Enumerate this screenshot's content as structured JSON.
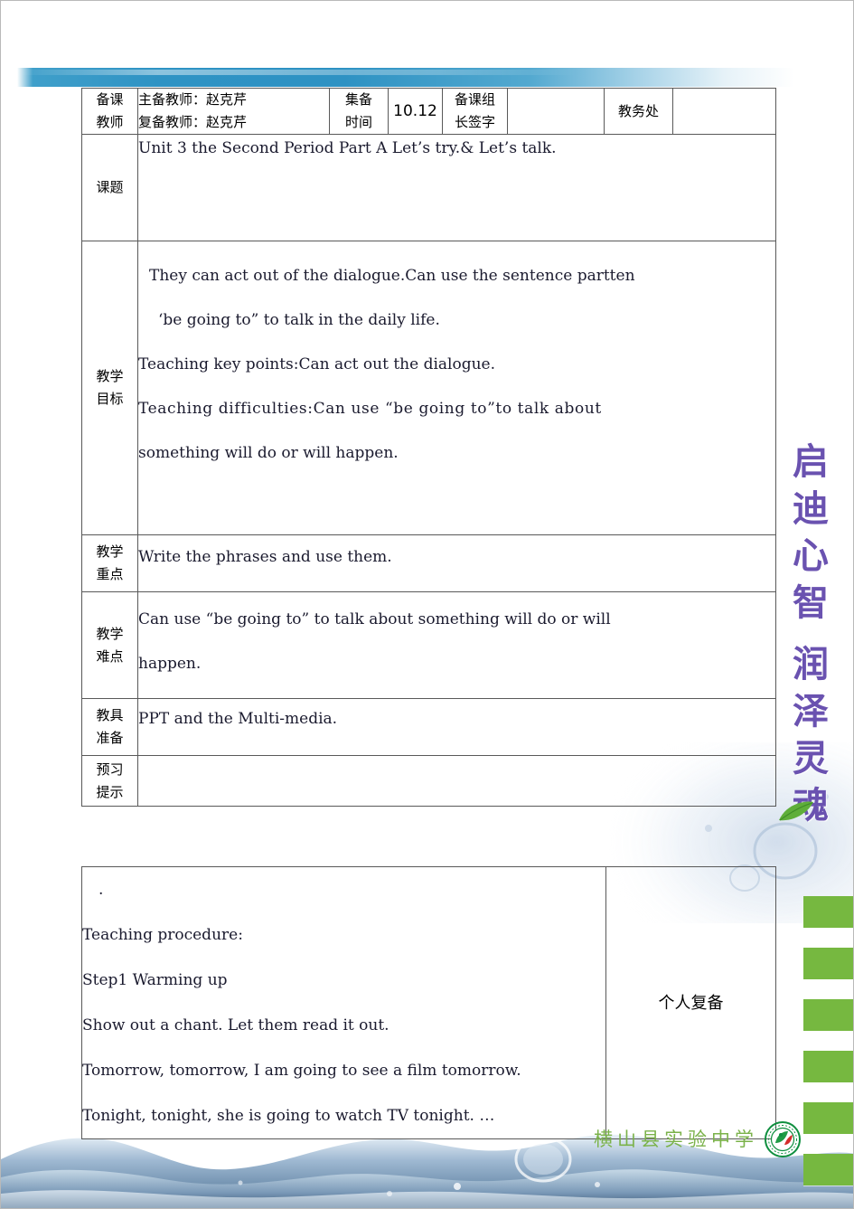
{
  "document": {
    "title_watermark": [
      "启",
      "迪",
      "心",
      "智",
      "润",
      "泽",
      "灵",
      "魂"
    ],
    "school_name": "横山县实验中学"
  },
  "table": {
    "header_row": {
      "label": "备课\n教师",
      "label_line1": "备课",
      "label_line2": "教师",
      "teacher_main": "主备教师：赵克芹",
      "teacher_sub": "复备教师：赵克芹",
      "time_label_line1": "集备",
      "time_label_line2": "时间",
      "time_value": "10.12",
      "signature_label_line1": "备课组",
      "signature_label_line2": "长签字",
      "signature_value": "",
      "office_label": "教务处",
      "office_value": ""
    },
    "topic_row": {
      "label": "课题",
      "value": "Unit 3 the Second Period Part A Let’s try.& Let’s talk."
    },
    "objectives_row": {
      "label_line1": "教学",
      "label_line2": "目标",
      "lines": [
        "They can act out of the dialogue.Can use the sentence partten",
        "‘be going to”  to talk in the daily life.",
        "Teaching key points:Can act out the dialogue.",
        "Teaching difficulties:Can use “be going to”to talk about",
        "something will do or will happen."
      ]
    },
    "key_points_row": {
      "label_line1": "教学",
      "label_line2": "重点",
      "value": "Write the phrases and use them."
    },
    "difficulties_row": {
      "label_line1": "教学",
      "label_line2": "难点",
      "lines": [
        "Can use “be going to” to talk about something will do or will",
        "happen."
      ]
    },
    "materials_row": {
      "label_line1": "教具",
      "label_line2": "准备",
      "value": "PPT and the Multi-media."
    },
    "preview_row": {
      "label_line1": "预习",
      "label_line2": "提示",
      "value": ""
    },
    "procedure_row": {
      "lines": [
        ".",
        "Teaching procedure:",
        "Step1 Warming up",
        "Show out a chant. Let them read it out.",
        "Tomorrow, tomorrow, I am going to see a film tomorrow.",
        "Tonight, tonight, she is going to watch TV tonight. …"
      ],
      "side_label": "个人复备"
    }
  },
  "colors": {
    "table_border": "#595959",
    "top_bar_blue": "#2f93c4",
    "slogan_purple": "#6a52b0",
    "green_block": "#76b840",
    "school_green": "#7bb24a"
  }
}
